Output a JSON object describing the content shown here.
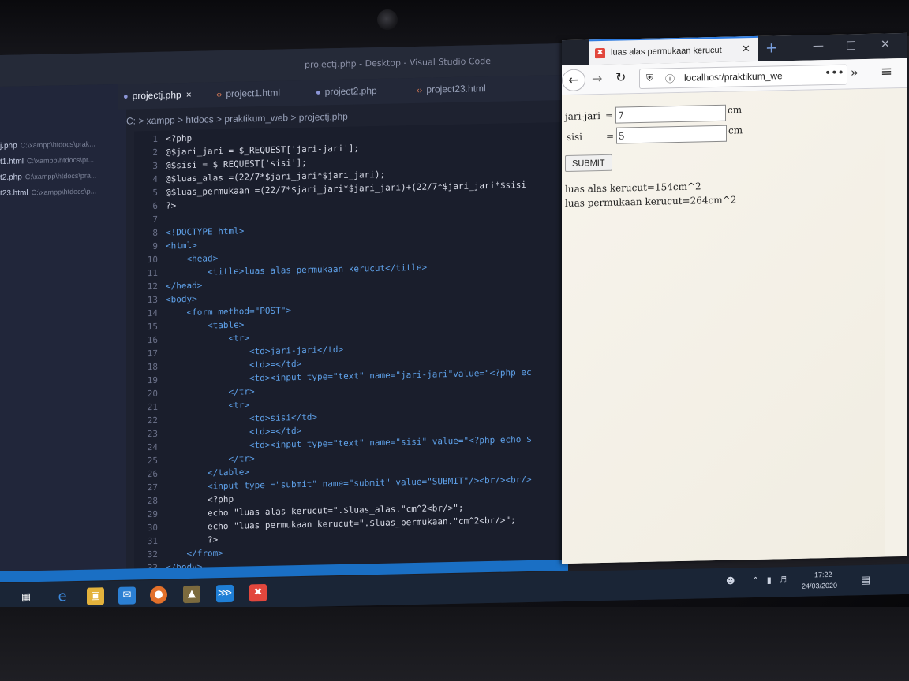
{
  "vscode": {
    "window_title": "projectj.php - Desktop - Visual Studio Code",
    "sidebar_files": [
      {
        "name": "j.php",
        "path": "C:\\xampp\\htdocs\\prak..."
      },
      {
        "name": "t1.html",
        "path": "C:\\xampp\\htdocs\\pr..."
      },
      {
        "name": "t2.php",
        "path": "C:\\xampp\\htdocs\\pra..."
      },
      {
        "name": "t23.html",
        "path": "C:\\xampp\\htdocs\\p..."
      }
    ],
    "tabs": [
      {
        "label": "projectj.php",
        "icon": "php-icon",
        "active": true
      },
      {
        "label": "project1.html",
        "icon": "html-icon",
        "active": false
      },
      {
        "label": "project2.php",
        "icon": "php-icon",
        "active": false
      },
      {
        "label": "project23.html",
        "icon": "html-icon",
        "active": false
      }
    ],
    "breadcrumb": "C: > xampp > htdocs > praktikum_web > projectj.php",
    "code_lines": [
      {
        "n": "1",
        "text": "<?php"
      },
      {
        "n": "2",
        "text": "@$jari_jari = $_REQUEST['jari-jari'];"
      },
      {
        "n": "3",
        "text": "@$sisi = $_REQUEST['sisi'];"
      },
      {
        "n": "4",
        "text": "@$luas_alas =(22/7*$jari_jari*$jari_jari);"
      },
      {
        "n": "5",
        "text": "@$luas_permukaan =(22/7*$jari_jari*$jari_jari)+(22/7*$jari_jari*$sisi"
      },
      {
        "n": "6",
        "text": "?>"
      },
      {
        "n": "7",
        "text": ""
      },
      {
        "n": "8",
        "text": "<!DOCTYPE html>"
      },
      {
        "n": "9",
        "text": "<html>"
      },
      {
        "n": "10",
        "text": "    <head>"
      },
      {
        "n": "11",
        "text": "        <title>luas alas permukaan kerucut</title>"
      },
      {
        "n": "12",
        "text": "</head>"
      },
      {
        "n": "13",
        "text": "<body>"
      },
      {
        "n": "14",
        "text": "    <form method=\"POST\">"
      },
      {
        "n": "15",
        "text": "        <table>"
      },
      {
        "n": "16",
        "text": "            <tr>"
      },
      {
        "n": "17",
        "text": "                <td>jari-jari</td>"
      },
      {
        "n": "18",
        "text": "                <td>=</td>"
      },
      {
        "n": "19",
        "text": "                <td><input type=\"text\" name=\"jari-jari\"value=\"<?php ec"
      },
      {
        "n": "20",
        "text": "            </tr>"
      },
      {
        "n": "21",
        "text": "            <tr>"
      },
      {
        "n": "22",
        "text": "                <td>sisi</td>"
      },
      {
        "n": "23",
        "text": "                <td>=</td>"
      },
      {
        "n": "24",
        "text": "                <td><input type=\"text\" name=\"sisi\" value=\"<?php echo $"
      },
      {
        "n": "25",
        "text": "            </tr>"
      },
      {
        "n": "26",
        "text": "        </table>"
      },
      {
        "n": "27",
        "text": "        <input type =\"submit\" name=\"submit\" value=\"SUBMIT\"/><br/><br/>"
      },
      {
        "n": "28",
        "text": "        <?php"
      },
      {
        "n": "29",
        "text": "        echo \"luas alas kerucut=\".$luas_alas.\"cm^2<br/>\";"
      },
      {
        "n": "30",
        "text": "        echo \"luas permukaan kerucut=\".$luas_permukaan.\"cm^2<br/>\";"
      },
      {
        "n": "31",
        "text": "        ?>"
      },
      {
        "n": "32",
        "text": "    </from>"
      },
      {
        "n": "33",
        "text": "</body>"
      }
    ]
  },
  "firefox": {
    "tab_title": "luas alas permukaan kerucut",
    "url": "localhost/praktikum_we",
    "form": {
      "row1": {
        "label": "jari-jari",
        "eq": "=",
        "value": "7",
        "unit": "cm"
      },
      "row2": {
        "label": "sisi",
        "eq": "=",
        "value": "5",
        "unit": "cm"
      },
      "submit_label": "SUBMIT"
    },
    "output": [
      "luas alas kerucut=154cm^2",
      "luas permukaan kerucut=264cm^2"
    ]
  },
  "taskbar": {
    "time": "17:22",
    "date": "24/03/2020"
  }
}
